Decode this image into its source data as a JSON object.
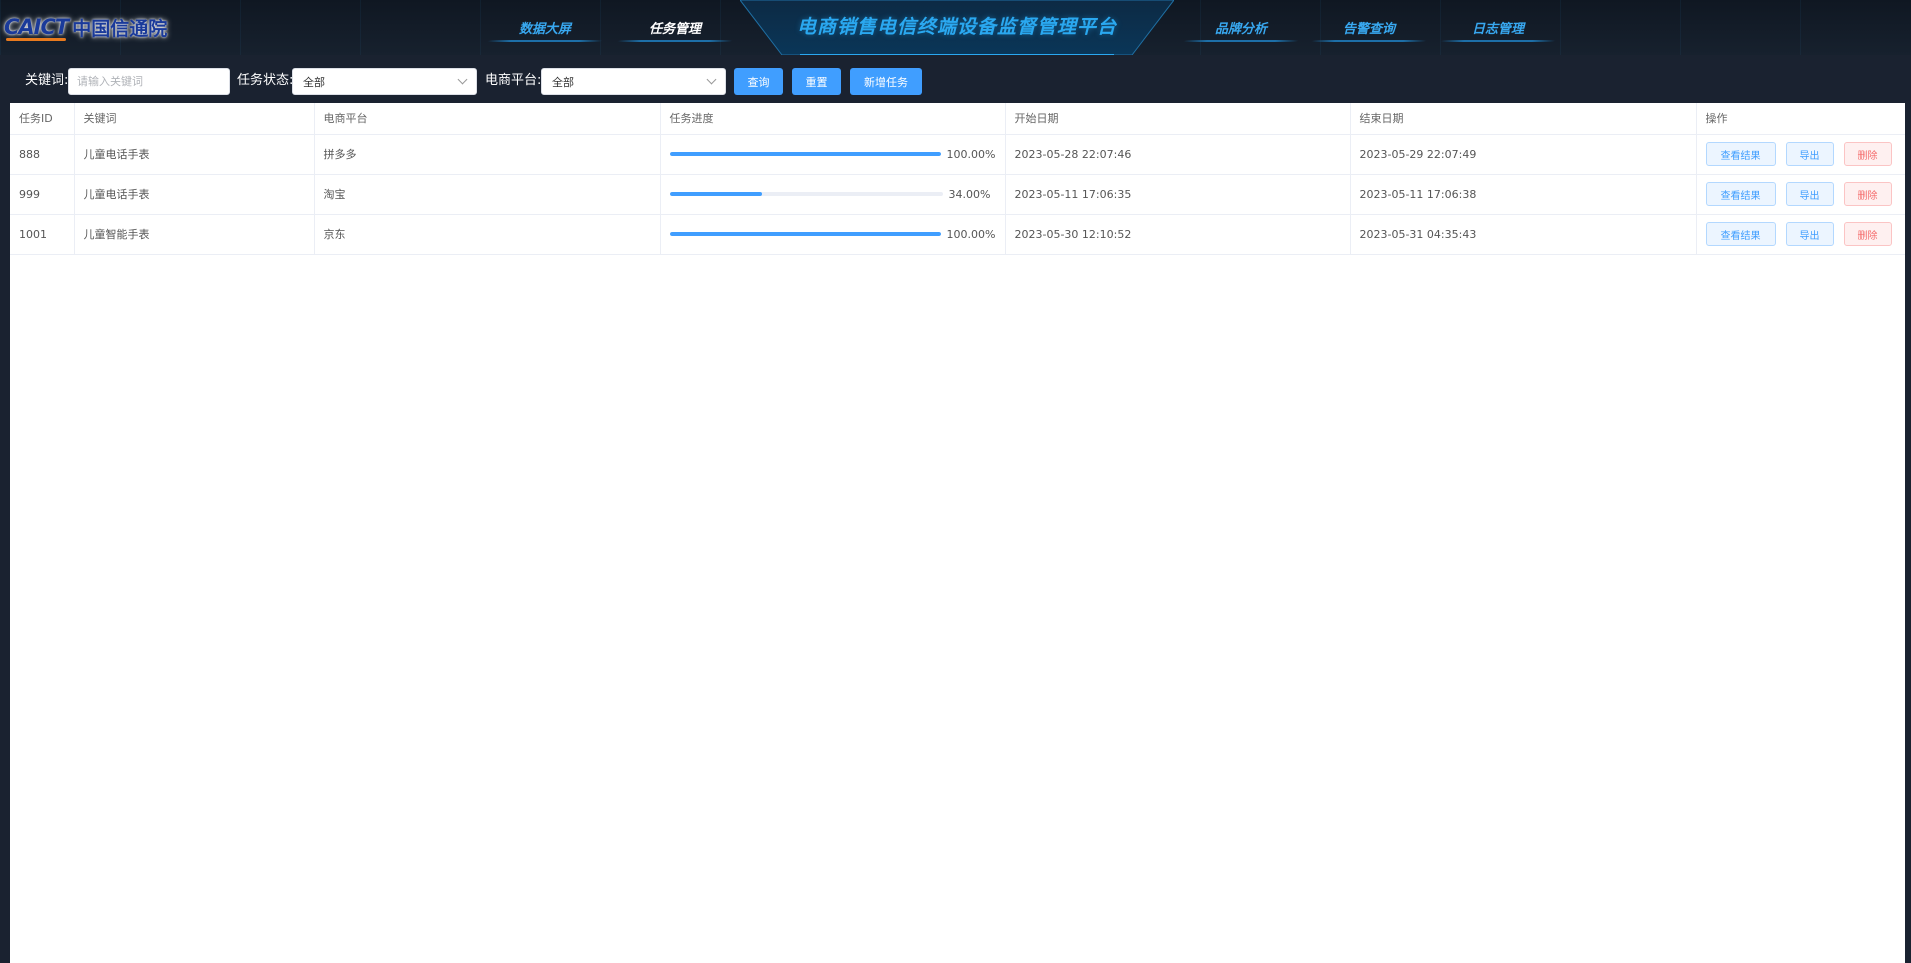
{
  "header": {
    "logo_en": "CAICT",
    "logo_cn": "中国信通院",
    "title": "电商销售电信终端设备监督管理平台",
    "nav_left": [
      {
        "label": "数据大屏",
        "active": false
      },
      {
        "label": "任务管理",
        "active": true
      }
    ],
    "nav_right": [
      {
        "label": "品牌分析",
        "active": false
      },
      {
        "label": "告警查询",
        "active": false
      },
      {
        "label": "日志管理",
        "active": false
      }
    ]
  },
  "search": {
    "keyword_label": "关键词:",
    "keyword_placeholder": "请输入关键词",
    "keyword_value": "",
    "status_label": "任务状态:",
    "status_value": "全部",
    "platform_label": "电商平台:",
    "platform_value": "全部",
    "query_button": "查询",
    "reset_button": "重置",
    "add_button": "新增任务"
  },
  "table": {
    "columns": [
      "任务ID",
      "关键词",
      "电商平台",
      "任务进度",
      "开始日期",
      "结束日期",
      "操作"
    ],
    "rows": [
      {
        "id": "888",
        "keyword": "儿童电话手表",
        "platform": "拼多多",
        "progress": 100,
        "progress_text": "100.00%",
        "start": "2023-05-28 22:07:46",
        "end": "2023-05-29 22:07:49"
      },
      {
        "id": "999",
        "keyword": "儿童电话手表",
        "platform": "淘宝",
        "progress": 34,
        "progress_text": "34.00%",
        "start": "2023-05-11 17:06:35",
        "end": "2023-05-11 17:06:38"
      },
      {
        "id": "1001",
        "keyword": "儿童智能手表",
        "platform": "京东",
        "progress": 100,
        "progress_text": "100.00%",
        "start": "2023-05-30 12:10:52",
        "end": "2023-05-31 04:35:43"
      }
    ],
    "actions": {
      "view": "查看结果",
      "export": "导出",
      "delete": "删除"
    }
  },
  "colors": {
    "accent": "#409eff",
    "danger": "#f56c6c",
    "header_bg": "#131c28",
    "nav_text": "#38a8f0"
  }
}
